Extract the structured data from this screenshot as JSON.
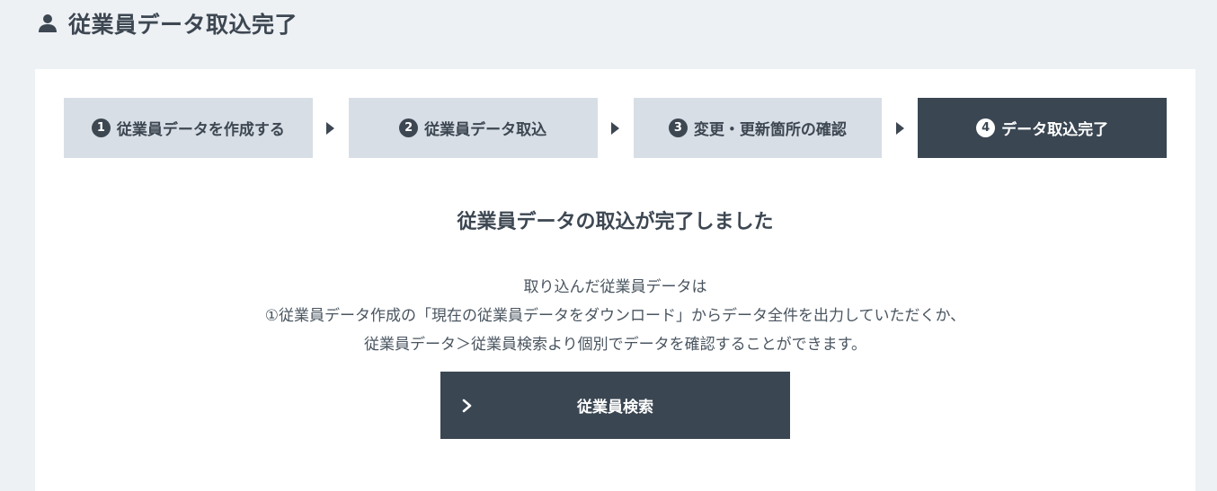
{
  "header": {
    "title": "従業員データ取込完了",
    "icon": "person-icon"
  },
  "steps": [
    {
      "num": "1",
      "label": "従業員データを作成する",
      "active": false
    },
    {
      "num": "2",
      "label": "従業員データ取込",
      "active": false
    },
    {
      "num": "3",
      "label": "変更・更新箇所の確認",
      "active": false
    },
    {
      "num": "4",
      "label": "データ取込完了",
      "active": true
    }
  ],
  "main": {
    "title": "従業員データの取込が完了しました",
    "desc_lines": [
      "取り込んだ従業員データは",
      "①従業員データ作成の「現在の従業員データをダウンロード」からデータ全件を出力していただくか、",
      "従業員データ＞従業員検索より個別でデータを確認することができます。"
    ],
    "button_label": "従業員検索",
    "button_icon": "chevron-right-icon"
  },
  "colors": {
    "background": "#eef1f4",
    "card": "#ffffff",
    "step_inactive": "#d8dee5",
    "step_active": "#3a4652",
    "text": "#3d4752"
  }
}
